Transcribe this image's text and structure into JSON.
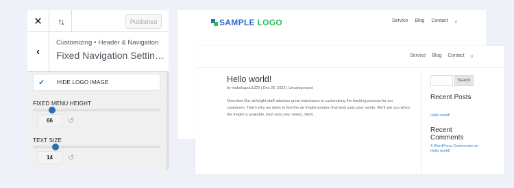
{
  "customizer": {
    "topbar": {
      "close_icon": "close-icon",
      "sort_icon": "sort-arrows-icon",
      "publish_label": "Published"
    },
    "section": {
      "breadcrumb_parent": "Customizing",
      "breadcrumb_separator": "•",
      "breadcrumb_current": "Header & Navigation",
      "title": "Fixed Navigation Settin…"
    },
    "controls": {
      "hide_logo": {
        "label": "HIDE LOGO IMAGE",
        "checked": true
      },
      "fixed_menu_height": {
        "label": "FIXED MENU HEIGHT",
        "value": "66",
        "slider_fraction": 0.15
      },
      "text_size": {
        "label": "TEXT SIZE",
        "value": "14",
        "slider_fraction": 0.18
      }
    },
    "colors": {
      "accent": "#2271b1",
      "slider_thumb": "#2a6fb0"
    }
  },
  "preview_back": {
    "logo_text_part1": "SAMPLE",
    "logo_text_part2": " LOGO",
    "nav": [
      "Service",
      "Blog",
      "Contact"
    ]
  },
  "preview_front": {
    "nav": [
      "Service",
      "Blog",
      "Contact"
    ],
    "post": {
      "title": "Hello world!",
      "meta": "by mubokapou1329 | Dec 20, 2022 | Uncategorized",
      "excerpt": "Overview Our airfreight staff attaches great importance to customizing the booking process for our customers. That's why we strive to find the air freight solution that best suits your needs. We'll ask you when the freight is available, best suits your needs, We'll..."
    },
    "sidebar": {
      "search_button": "Search",
      "recent_posts_title": "Recent Posts",
      "recent_post_link": "Hello world!",
      "recent_comments_title": "Recent Comments",
      "recent_comment": "A WordPress Commenter on Hello world!"
    },
    "colors": {
      "logo_blue": "#2b6cc8",
      "logo_green": "#2dbd5b",
      "link": "#2b87da"
    }
  }
}
